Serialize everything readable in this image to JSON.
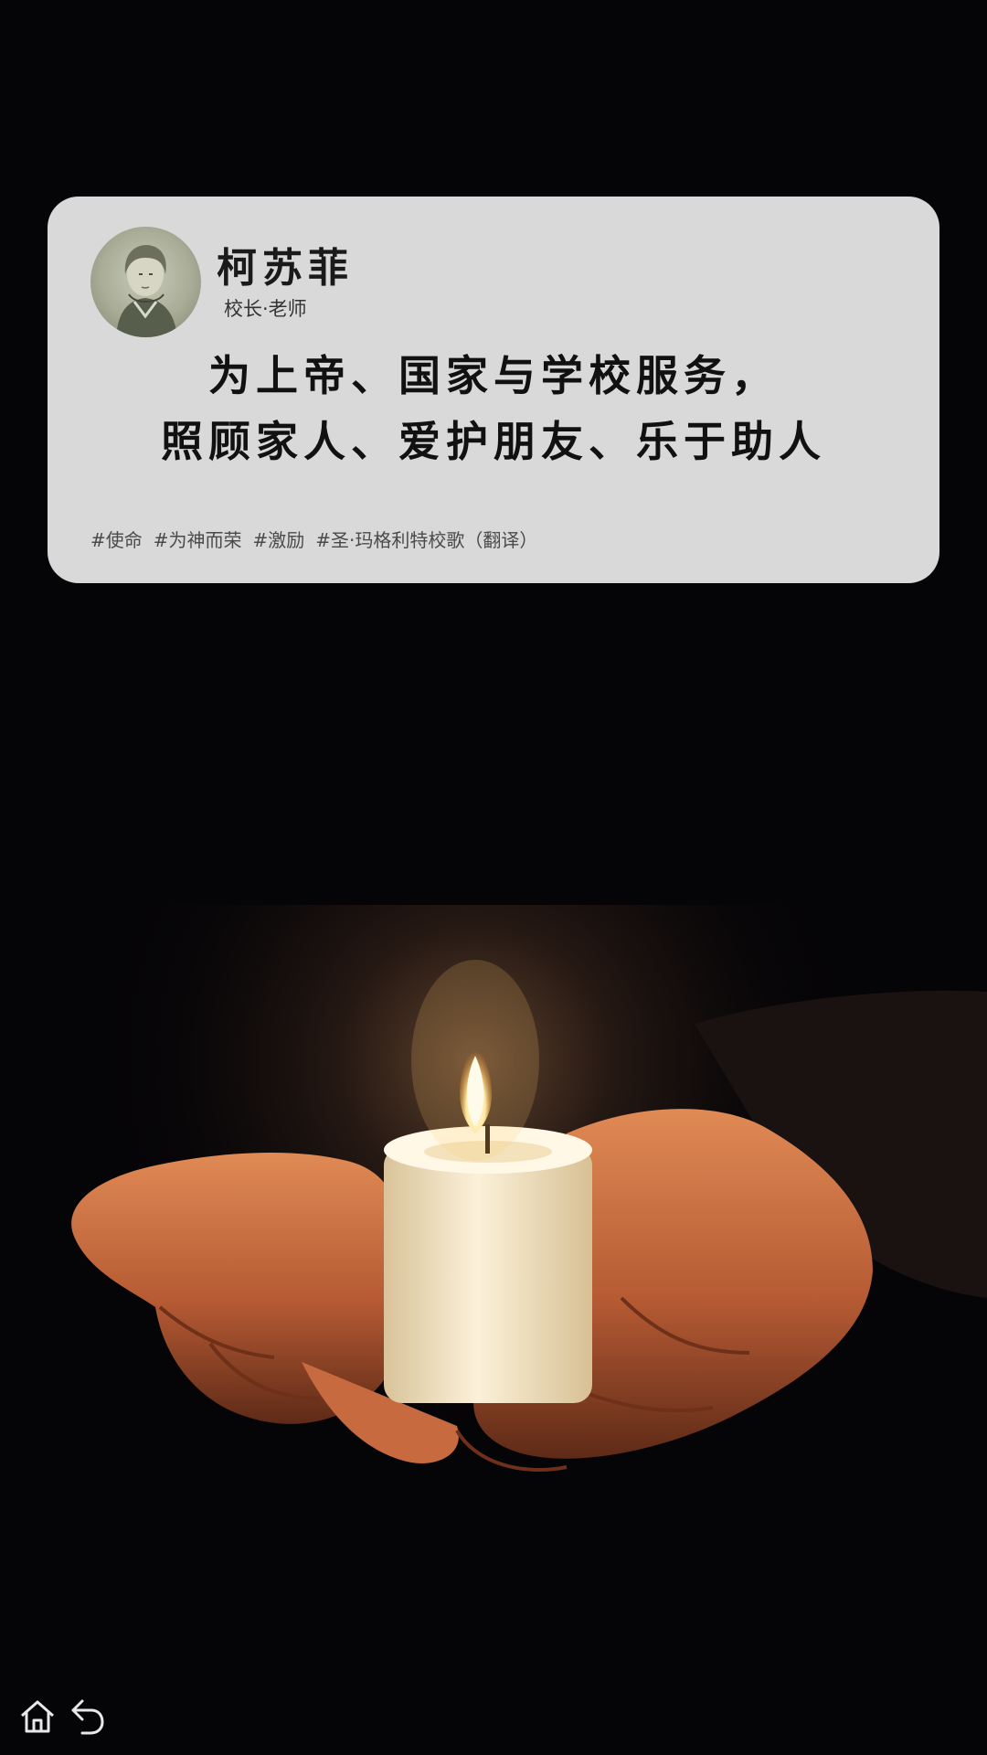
{
  "card": {
    "author_name": "柯苏菲",
    "author_role": "校长·老师",
    "quote_lines": [
      "为上帝、国家与学校服务，",
      "照顾家人、爱护朋友、乐于助人"
    ],
    "tags": [
      "#使命",
      "#为神而荣",
      "#激励",
      "#圣·玛格利特校歌（翻译）"
    ]
  },
  "photo": {
    "subject": "candle-in-hands"
  },
  "nav": {
    "home_icon": "home-icon",
    "back_icon": "back-icon"
  },
  "colors": {
    "background": "#050407",
    "card": "#d9d9d9",
    "quote_text": "#111111",
    "tag_text": "#4a4a4a",
    "icon": "#e8e8e8"
  }
}
